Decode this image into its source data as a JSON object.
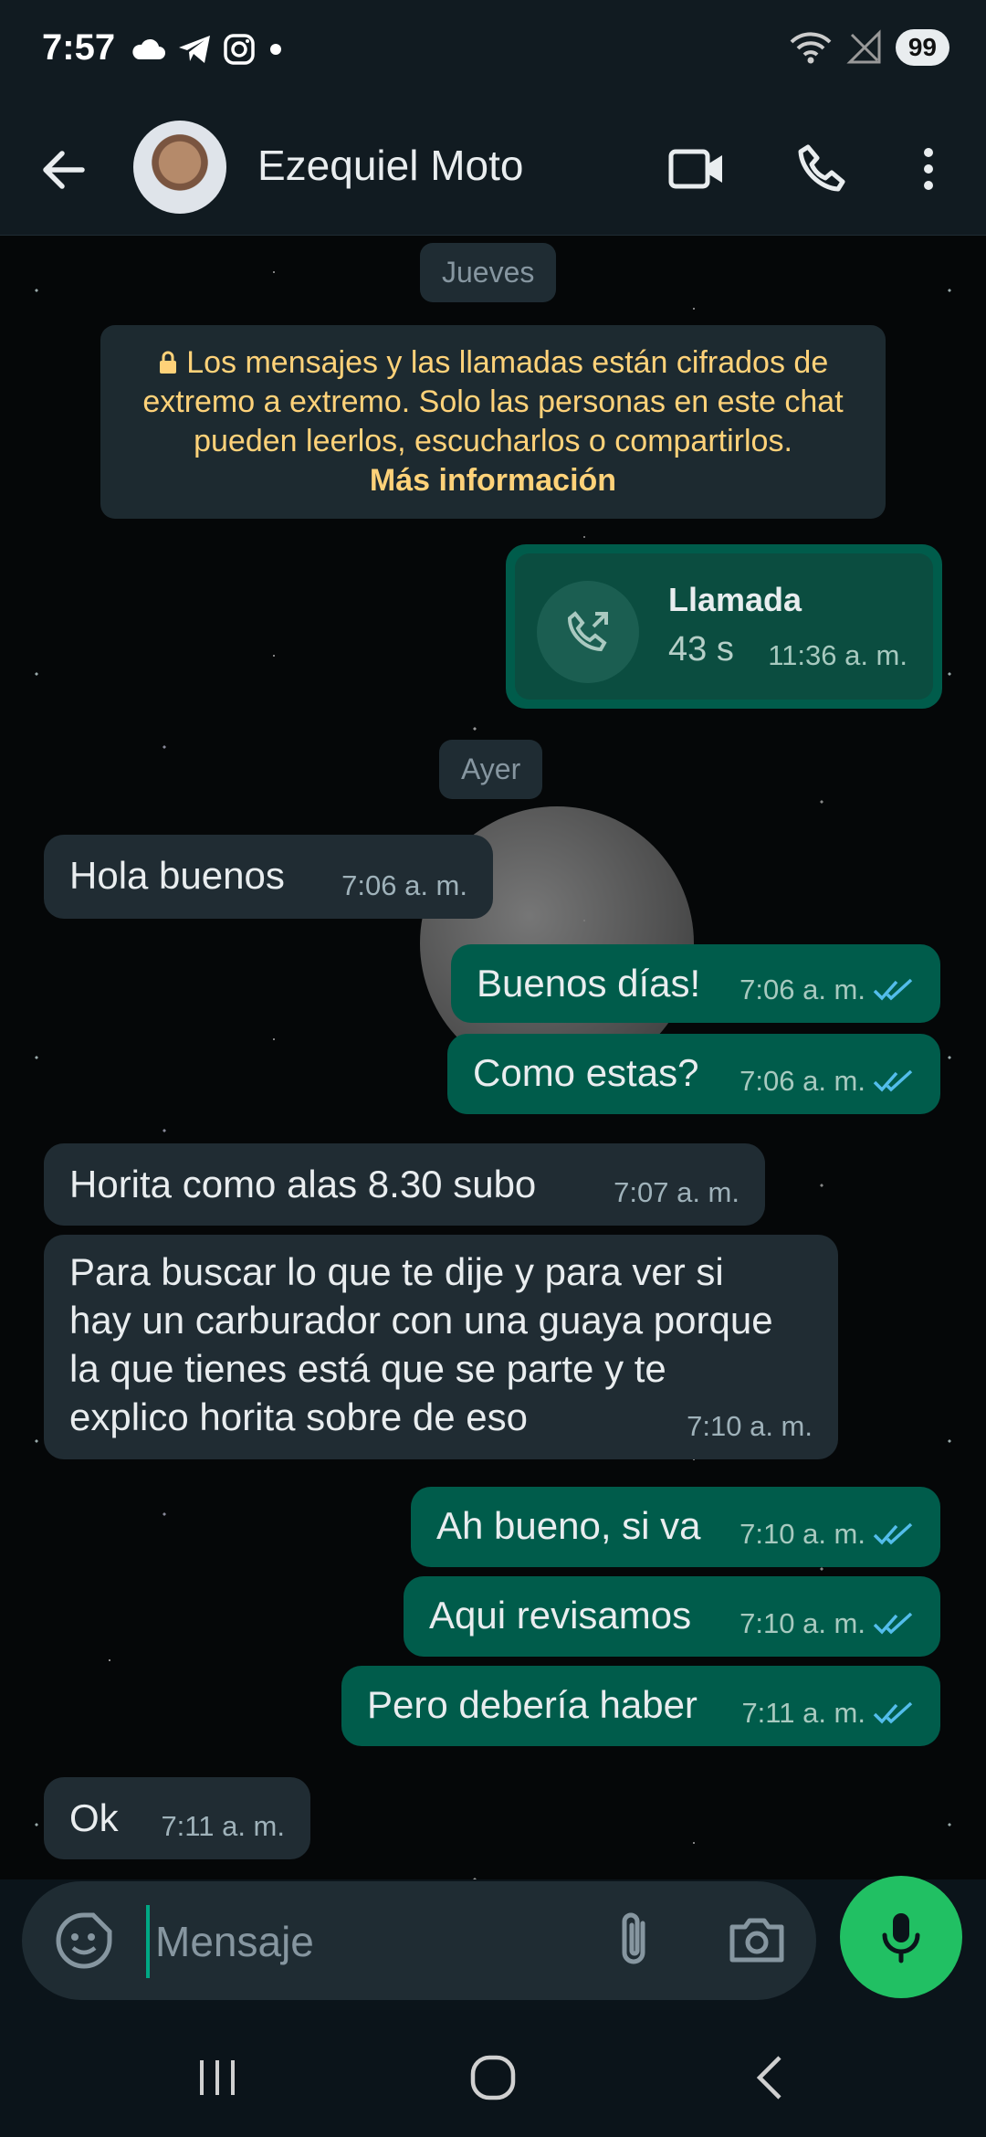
{
  "status_bar": {
    "time": "7:57",
    "battery": "99",
    "icons": [
      "cloud-icon",
      "telegram-icon",
      "instagram-icon",
      "dot-icon",
      "wifi-icon",
      "no-signal-icon"
    ]
  },
  "header": {
    "contact_name": "Ezequiel Moto",
    "icons": [
      "back-arrow-icon",
      "video-call-icon",
      "phone-icon",
      "more-vert-icon"
    ]
  },
  "chat": {
    "date_jueves": "Jueves",
    "e2e_notice": "Los mensajes y las llamadas están cifrados de extremo a extremo. Solo las personas en este chat pueden leerlos, escucharlos o compartirlos.",
    "e2e_link": "Más información",
    "call": {
      "title": "Llamada",
      "duration": "43 s",
      "time": "11:36 a. m."
    },
    "date_ayer": "Ayer",
    "messages": [
      {
        "dir": "in",
        "text": "Hola buenos",
        "time": "7:06 a. m."
      },
      {
        "dir": "out",
        "text": "Buenos días!",
        "time": "7:06 a. m."
      },
      {
        "dir": "out",
        "text": "Como estas?",
        "time": "7:06 a. m."
      },
      {
        "dir": "in",
        "text": "Horita como alas 8.30 subo",
        "time": "7:07 a. m."
      },
      {
        "dir": "in",
        "text": "Para buscar lo que te dije y para ver si hay un carburador con una guaya porque la que tienes está que se parte y te explico horita sobre de eso",
        "time": "7:10 a. m."
      },
      {
        "dir": "out",
        "text": "Ah bueno, si va",
        "time": "7:10 a. m."
      },
      {
        "dir": "out",
        "text": "Aqui revisamos",
        "time": "7:10 a. m."
      },
      {
        "dir": "out",
        "text": "Pero debería haber",
        "time": "7:11 a. m."
      },
      {
        "dir": "in",
        "text": "Ok",
        "time": "7:11 a. m."
      }
    ]
  },
  "input": {
    "placeholder": "Mensaje",
    "value": ""
  },
  "colors": {
    "incoming_bubble": "#202c33",
    "outgoing_bubble": "#005c4b",
    "accent": "#21c063",
    "read_ticks": "#53bdeb",
    "notice_text": "#ffd279"
  }
}
